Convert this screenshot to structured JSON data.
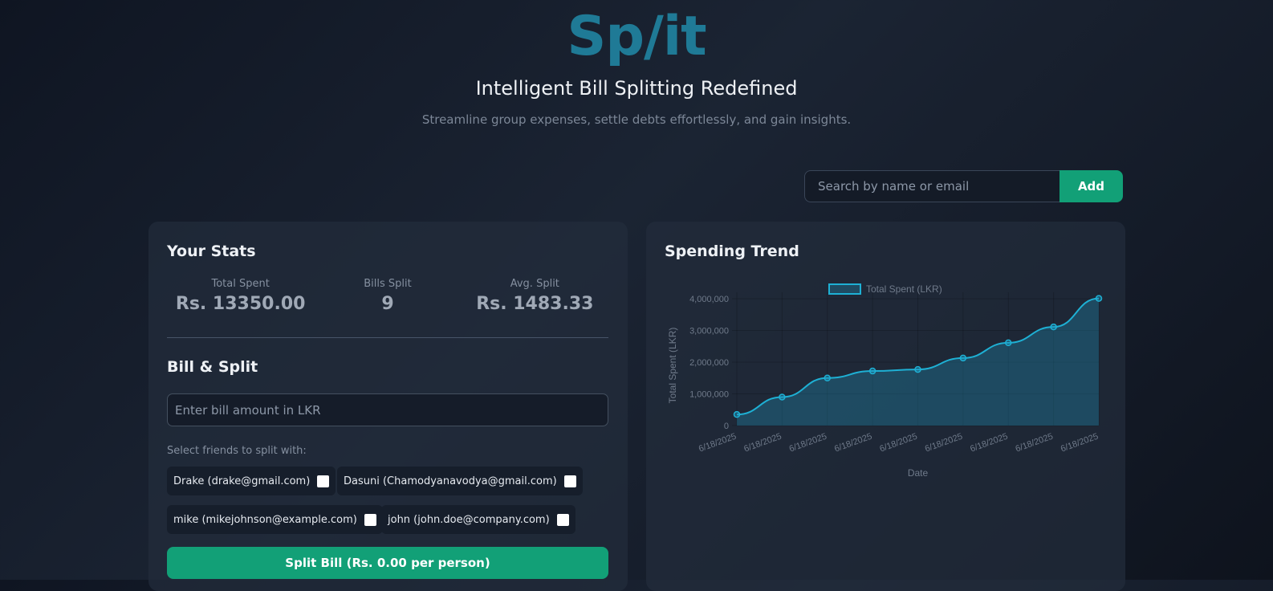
{
  "header": {
    "logo": "Sp/it",
    "tagline": "Intelligent Bill Splitting Redefined",
    "subtitle": "Streamline group expenses, settle debts effortlessly, and gain insights."
  },
  "search": {
    "placeholder": "Search by name or email",
    "add_label": "Add"
  },
  "stats": {
    "title": "Your Stats",
    "items": [
      {
        "label": "Total Spent",
        "value": "Rs. 13350.00"
      },
      {
        "label": "Bills Split",
        "value": "9"
      },
      {
        "label": "Avg. Split",
        "value": "Rs. 1483.33"
      }
    ]
  },
  "bill": {
    "title": "Bill & Split",
    "amount_placeholder": "Enter bill amount in LKR",
    "select_label": "Select friends to split with:",
    "friends": [
      {
        "label": "Drake (drake@gmail.com)",
        "checked": false
      },
      {
        "label": "Dasuni (Chamodyanavodya@gmail.com)",
        "checked": false
      },
      {
        "label": "mike (mikejohnson@example.com)",
        "checked": false
      },
      {
        "label": "john (john.doe@company.com)",
        "checked": false
      }
    ],
    "split_button": "Split Bill (Rs. 0.00 per person)"
  },
  "trend": {
    "title": "Spending Trend"
  },
  "colors": {
    "accent": "#12a077",
    "logo": "#1f7a96",
    "line": "#1eb0d4"
  },
  "chart_data": {
    "type": "area",
    "x": [
      "6/18/2025",
      "6/18/2025",
      "6/18/2025",
      "6/18/2025",
      "6/18/2025",
      "6/18/2025",
      "6/18/2025",
      "6/18/2025",
      "6/18/2025"
    ],
    "series": [
      {
        "name": "Total Spent (LKR)",
        "values": [
          350000,
          900000,
          1500000,
          1720000,
          1770000,
          2130000,
          2610000,
          3110000,
          4010000
        ]
      }
    ],
    "xlabel": "Date",
    "ylabel": "Total Spent (LKR)",
    "ylim": [
      0,
      4000000
    ],
    "yticks": [
      "0",
      "1,000,000",
      "2,000,000",
      "3,000,000",
      "4,000,000"
    ],
    "legend": "top",
    "grid": true
  }
}
